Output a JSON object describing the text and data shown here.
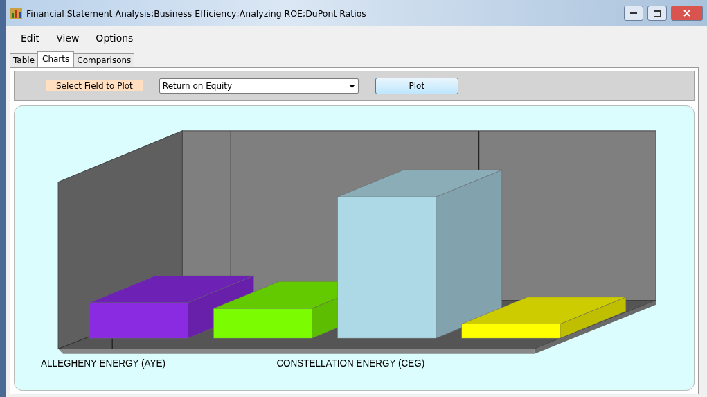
{
  "window": {
    "title": "Financial Statement Analysis;Business Efficiency;Analyzing ROE;DuPont Ratios"
  },
  "menu": [
    "Edit",
    "View",
    "Options"
  ],
  "tabs": [
    {
      "label": "Table",
      "selected": false
    },
    {
      "label": "Charts",
      "selected": true
    },
    {
      "label": "Comparisons",
      "selected": false
    }
  ],
  "toolbar": {
    "field_label": "Select Field to Plot",
    "field_value": "Return on Equity",
    "plot_button": "Plot"
  },
  "chart": {
    "bars": [
      {
        "color": "#8a2be2"
      },
      {
        "color": "#7cfc00"
      },
      {
        "color": "#add8e6"
      },
      {
        "color": "#ffff00"
      }
    ],
    "category_labels": [
      "ALLEGHENY ENERGY (AYE)",
      "CONSTELLATION ENERGY (CEG)"
    ]
  }
}
